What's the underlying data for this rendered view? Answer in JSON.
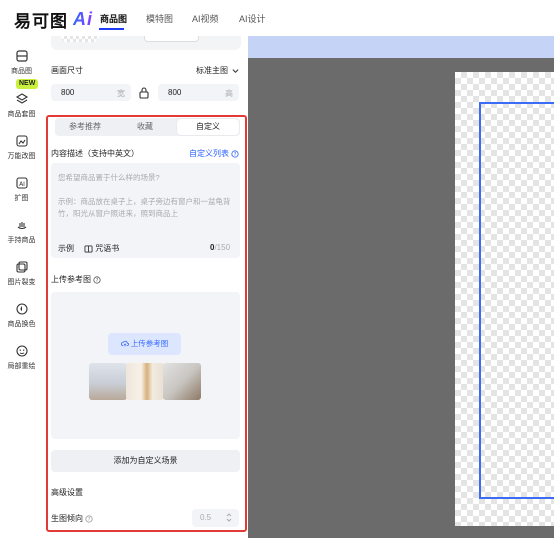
{
  "header": {
    "logo_text": "易可图",
    "logo_ai": "Ai",
    "nav": [
      "商品图",
      "模特图",
      "AI视频",
      "AI设计"
    ],
    "active_nav": 0
  },
  "leftnav": {
    "items": [
      {
        "label": "商品图",
        "icon": "product-image-icon",
        "active": true
      },
      {
        "label": "商品套图",
        "icon": "layers-icon",
        "badge": "NEW"
      },
      {
        "label": "万能改图",
        "icon": "edit-image-icon"
      },
      {
        "label": "扩图",
        "icon": "expand-image-icon"
      },
      {
        "label": "手持商品",
        "icon": "hand-product-icon"
      },
      {
        "label": "图片裂变",
        "icon": "image-variation-icon"
      },
      {
        "label": "商品换色",
        "icon": "color-drop-icon"
      },
      {
        "label": "局部重绘",
        "icon": "face-redraw-icon"
      }
    ]
  },
  "panel": {
    "size_label": "画面尺寸",
    "size_preset": "标准主图",
    "width": "800",
    "width_unit": "宽",
    "height": "800",
    "height_unit": "高",
    "tabs": [
      "参考推荐",
      "收藏",
      "自定义"
    ],
    "active_tab": 2,
    "desc_label": "内容描述（支持中英文）",
    "custom_list_link": "自定义列表",
    "desc_placeholder": "您希望商品置于什么样的场景?",
    "desc_example": "示例：商品放在桌子上，桌子旁边有窗户和一盆龟背竹，阳光从窗户照进来，照到商品上",
    "example_label": "示例",
    "phrasebook_label": "咒语书",
    "char_count": "0",
    "char_max": "/150",
    "upload_ref_label": "上传参考图",
    "upload_button": "上传参考图",
    "add_custom_scene": "添加为自定义场景",
    "advanced_label": "高级设置",
    "tendency_label": "生图倾向",
    "tendency_value": "0.5"
  },
  "colors": {
    "accent": "#2a63ff",
    "highlight_frame": "#e23b35",
    "canvas_bg": "#6b6b6b",
    "new_badge": "#c8f03c"
  }
}
